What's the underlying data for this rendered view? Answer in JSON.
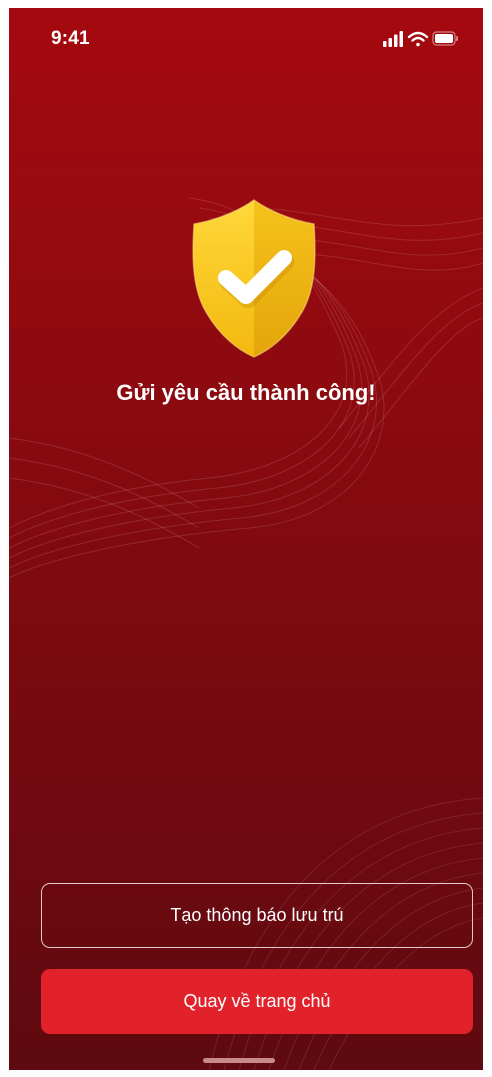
{
  "status_bar": {
    "time": "9:41",
    "icons": [
      "signal-icon",
      "wifi-icon",
      "battery-icon"
    ]
  },
  "hero": {
    "icon": "shield-check-icon",
    "title": "Gửi yêu cầu thành công!"
  },
  "actions": {
    "secondary_label": "Tạo thông báo lưu trú",
    "primary_label": "Quay về trang chủ"
  },
  "colors": {
    "background_top": "#a5090f",
    "background_bottom": "#5e0a10",
    "primary_button": "#e2222a",
    "shield": "#f5c518",
    "text": "#ffffff"
  }
}
